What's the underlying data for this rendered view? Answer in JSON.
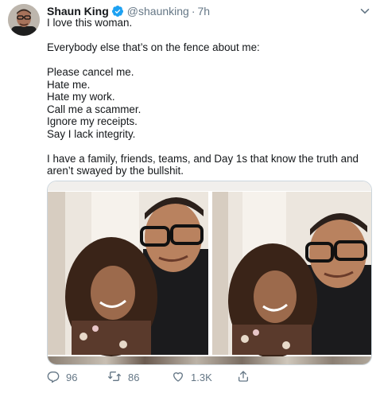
{
  "tweet": {
    "author_name": "Shaun King",
    "handle": "@shaunking",
    "separator": "·",
    "time": "7h",
    "lines": [
      "I love this woman.",
      "",
      "Everybody else that’s on the fence about me:",
      "",
      "Please cancel me.",
      "Hate me.",
      "Hate my work.",
      "Call me a scammer.",
      "Ignore my receipts.",
      "Say I lack integrity.",
      "",
      "I have a family, friends, teams, and Day 1s that know the truth and",
      "aren’t swayed by the bullshit."
    ]
  },
  "actions": {
    "replies": "96",
    "retweets": "86",
    "likes": "1.3K"
  },
  "colors": {
    "text": "#14171a",
    "secondary": "#657786",
    "verified": "#1da1f2",
    "border": "#ccd6dd"
  },
  "icons": [
    "verified-badge-icon",
    "chevron-down-icon",
    "reply-icon",
    "retweet-icon",
    "like-icon",
    "share-icon"
  ]
}
